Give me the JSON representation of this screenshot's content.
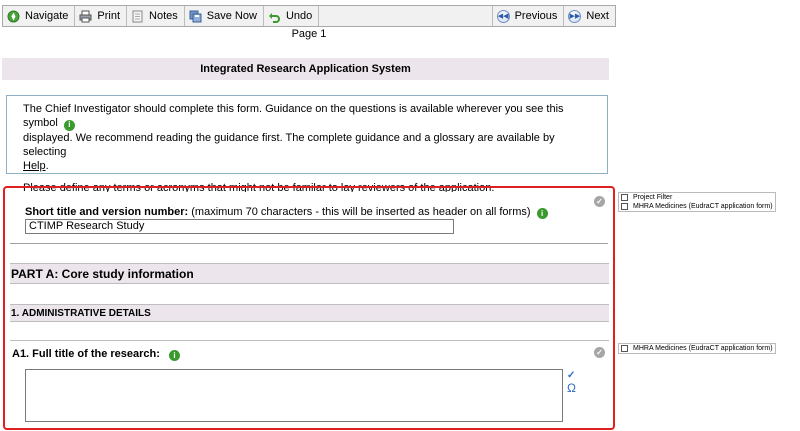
{
  "toolbar": {
    "navigate": "Navigate",
    "print": "Print",
    "notes": "Notes",
    "save_now": "Save Now",
    "undo": "Undo",
    "previous": "Previous",
    "next": "Next"
  },
  "page_number": "Page 1",
  "system_title": "Integrated Research Application System",
  "guidance": {
    "line1": "The Chief Investigator should complete this form. Guidance on the questions is available wherever you see this symbol",
    "line2": "displayed. We recommend reading the guidance first. The complete guidance and a glossary are available by selecting",
    "help_link": "Help",
    "help_suffix": ".",
    "line3": "Please define any terms or acronyms that might not be familar to lay reviewers of the application."
  },
  "short_title": {
    "label": "Short title and version number:",
    "hint": "(maximum 70 characters - this will be inserted as header on all forms)",
    "value": "CTIMP Research Study"
  },
  "part_a": "PART A: Core study information",
  "section_1": "1. ADMINISTRATIVE DETAILS",
  "a1": {
    "label": "A1. Full title of the research:",
    "value": ""
  },
  "side_filters_top": {
    "item1": "Project Filter",
    "item2": "MHRA Medicines (EudraCT application form)"
  },
  "side_filters_a1": {
    "item1": "MHRA Medicines (EudraCT application form)"
  },
  "colors": {
    "accent_red": "#e02020",
    "header_bar": "#ece6ec",
    "info_green": "#3a9a2e"
  }
}
